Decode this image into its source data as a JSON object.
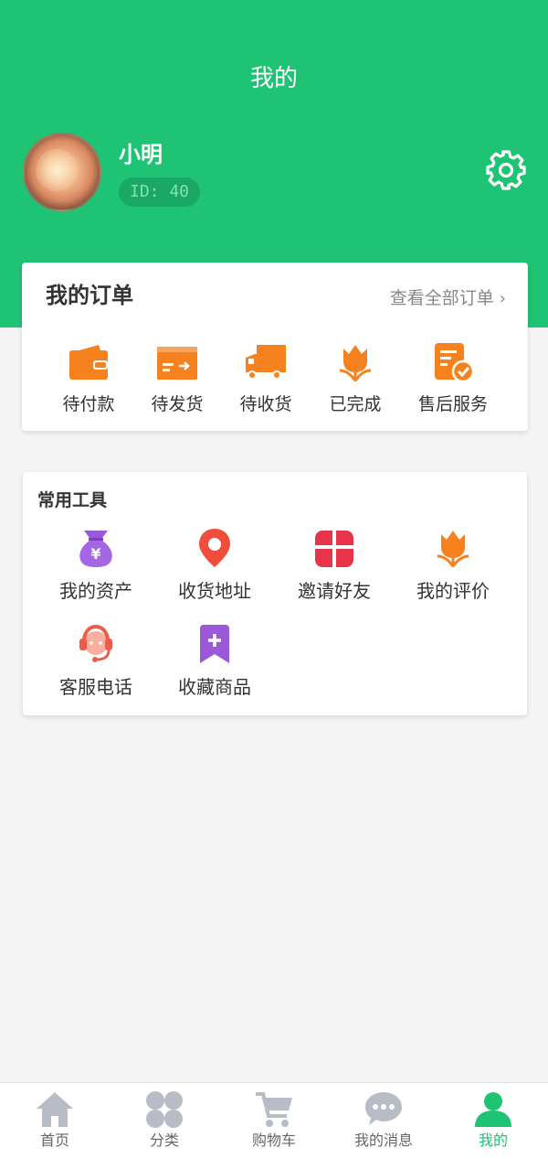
{
  "header": {
    "title": "我的",
    "user_name": "小明",
    "user_id": "ID: 40"
  },
  "orders": {
    "title": "我的订单",
    "view_all": "查看全部订单",
    "items": [
      {
        "label": "待付款",
        "icon": "wallet-icon"
      },
      {
        "label": "待发货",
        "icon": "shipping-box-icon"
      },
      {
        "label": "待收货",
        "icon": "truck-icon"
      },
      {
        "label": "已完成",
        "icon": "tulip-icon"
      },
      {
        "label": "售后服务",
        "icon": "document-check-icon"
      }
    ]
  },
  "tools": {
    "title": "常用工具",
    "items": [
      {
        "label": "我的资产",
        "icon": "money-bag-icon"
      },
      {
        "label": "收货地址",
        "icon": "location-pin-icon"
      },
      {
        "label": "邀请好友",
        "icon": "gift-icon"
      },
      {
        "label": "我的评价",
        "icon": "tulip-icon"
      },
      {
        "label": "客服电话",
        "icon": "headset-icon"
      },
      {
        "label": "收藏商品",
        "icon": "bookmark-plus-icon"
      }
    ]
  },
  "tabbar": {
    "items": [
      {
        "label": "首页",
        "icon": "home-icon"
      },
      {
        "label": "分类",
        "icon": "category-icon"
      },
      {
        "label": "购物车",
        "icon": "cart-icon"
      },
      {
        "label": "我的消息",
        "icon": "chat-icon"
      },
      {
        "label": "我的",
        "icon": "person-icon"
      }
    ],
    "active_index": 4
  },
  "colors": {
    "brand_green": "#1ec373",
    "order_icon_orange": "#f5821f",
    "tab_inactive": "#b8bcc6"
  }
}
